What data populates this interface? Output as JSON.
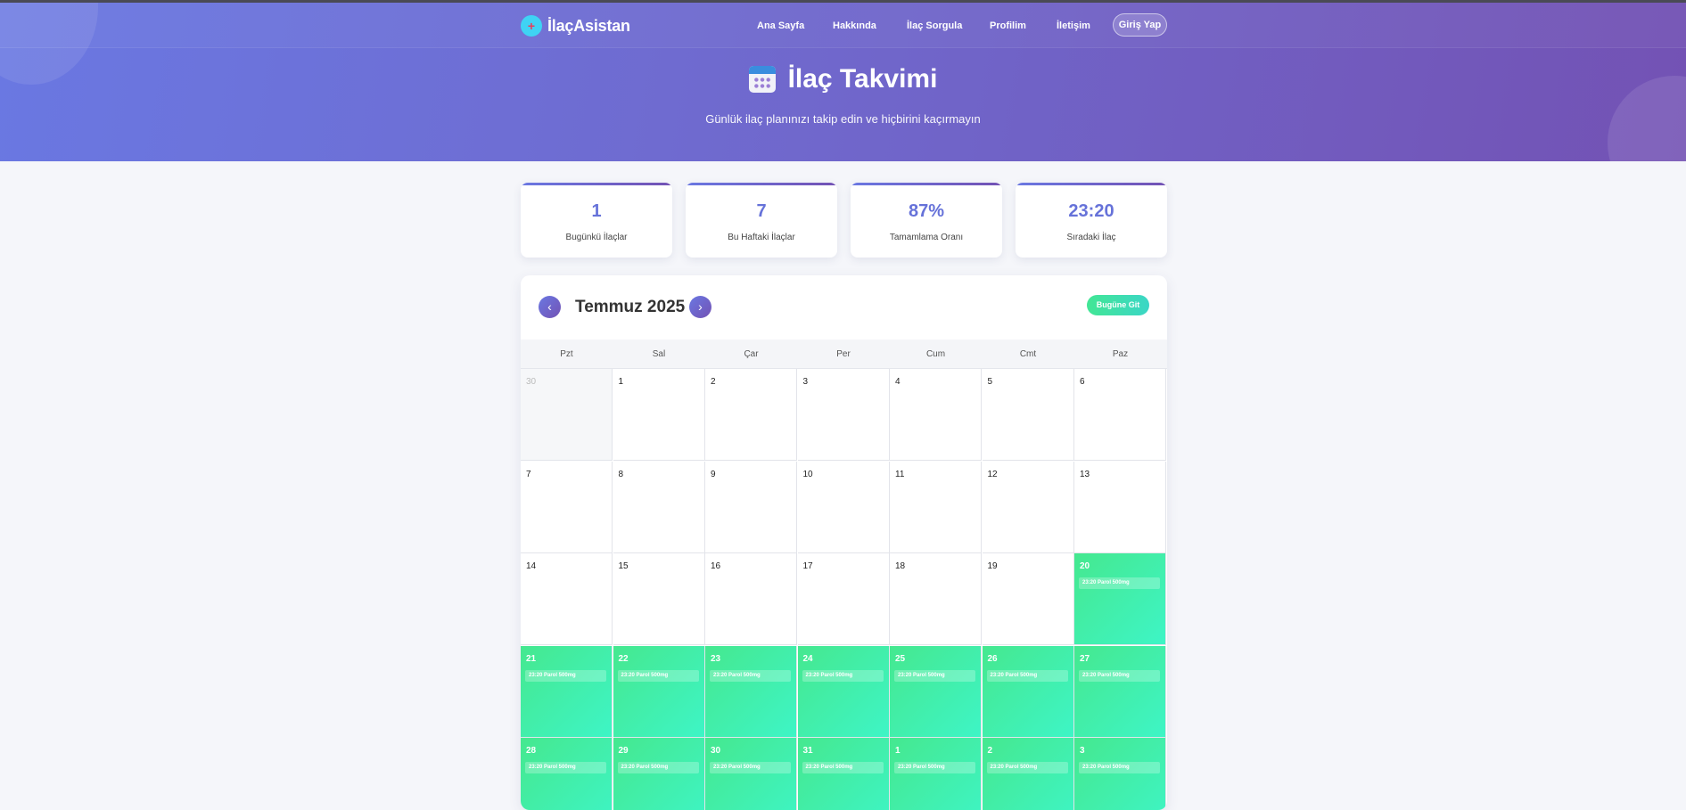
{
  "brand": {
    "name": "İlaçAsistan",
    "icon": "+"
  },
  "nav": {
    "links": [
      "Ana Sayfa",
      "Hakkında",
      "İlaç Sorgula",
      "Profilim",
      "İletişim"
    ],
    "login_label": "Giriş Yap"
  },
  "hero": {
    "title": "İlaç Takvimi",
    "subtitle": "Günlük ilaç planınızı takip edin ve hiçbirini kaçırmayın"
  },
  "stats": [
    {
      "value": "1",
      "label": "Bugünkü İlaçlar"
    },
    {
      "value": "7",
      "label": "Bu Haftaki İlaçlar"
    },
    {
      "value": "87%",
      "label": "Tamamlama Oranı"
    },
    {
      "value": "23:20",
      "label": "Sıradaki İlaç"
    }
  ],
  "calendar": {
    "month_title": "Temmuz 2025",
    "prev_label": "‹",
    "next_label": "›",
    "today_label": "Bugüne Git",
    "weekdays": [
      "Pzt",
      "Sal",
      "Çar",
      "Per",
      "Cum",
      "Cmt",
      "Paz"
    ],
    "days": [
      {
        "num": "30",
        "other": true,
        "meds": []
      },
      {
        "num": "1",
        "other": false,
        "meds": []
      },
      {
        "num": "2",
        "other": false,
        "meds": []
      },
      {
        "num": "3",
        "other": false,
        "meds": []
      },
      {
        "num": "4",
        "other": false,
        "meds": []
      },
      {
        "num": "5",
        "other": false,
        "meds": []
      },
      {
        "num": "6",
        "other": false,
        "meds": []
      },
      {
        "num": "7",
        "other": false,
        "meds": []
      },
      {
        "num": "8",
        "other": false,
        "meds": []
      },
      {
        "num": "9",
        "other": false,
        "meds": []
      },
      {
        "num": "10",
        "other": false,
        "meds": []
      },
      {
        "num": "11",
        "other": false,
        "meds": []
      },
      {
        "num": "12",
        "other": false,
        "meds": []
      },
      {
        "num": "13",
        "other": false,
        "meds": []
      },
      {
        "num": "14",
        "other": false,
        "meds": []
      },
      {
        "num": "15",
        "other": false,
        "meds": []
      },
      {
        "num": "16",
        "other": false,
        "meds": []
      },
      {
        "num": "17",
        "other": false,
        "meds": []
      },
      {
        "num": "18",
        "other": false,
        "meds": []
      },
      {
        "num": "19",
        "other": false,
        "meds": []
      },
      {
        "num": "20",
        "other": false,
        "meds": [
          "23:20 Parol 500mg"
        ]
      },
      {
        "num": "21",
        "other": false,
        "meds": [
          "23:20 Parol 500mg"
        ]
      },
      {
        "num": "22",
        "other": false,
        "meds": [
          "23:20 Parol 500mg"
        ]
      },
      {
        "num": "23",
        "other": false,
        "meds": [
          "23:20 Parol 500mg"
        ]
      },
      {
        "num": "24",
        "other": false,
        "meds": [
          "23:20 Parol 500mg"
        ]
      },
      {
        "num": "25",
        "other": false,
        "meds": [
          "23:20 Parol 500mg"
        ]
      },
      {
        "num": "26",
        "other": false,
        "meds": [
          "23:20 Parol 500mg"
        ]
      },
      {
        "num": "27",
        "other": false,
        "meds": [
          "23:20 Parol 500mg"
        ]
      },
      {
        "num": "28",
        "other": false,
        "meds": [
          "23:20 Parol 500mg"
        ]
      },
      {
        "num": "29",
        "other": false,
        "meds": [
          "23:20 Parol 500mg"
        ]
      },
      {
        "num": "30",
        "other": false,
        "meds": [
          "23:20 Parol 500mg"
        ]
      },
      {
        "num": "31",
        "other": false,
        "meds": [
          "23:20 Parol 500mg"
        ]
      },
      {
        "num": "1",
        "other": true,
        "meds": [
          "23:20 Parol 500mg"
        ]
      },
      {
        "num": "2",
        "other": true,
        "meds": [
          "23:20 Parol 500mg"
        ]
      },
      {
        "num": "3",
        "other": true,
        "meds": [
          "23:20 Parol 500mg"
        ]
      }
    ]
  }
}
